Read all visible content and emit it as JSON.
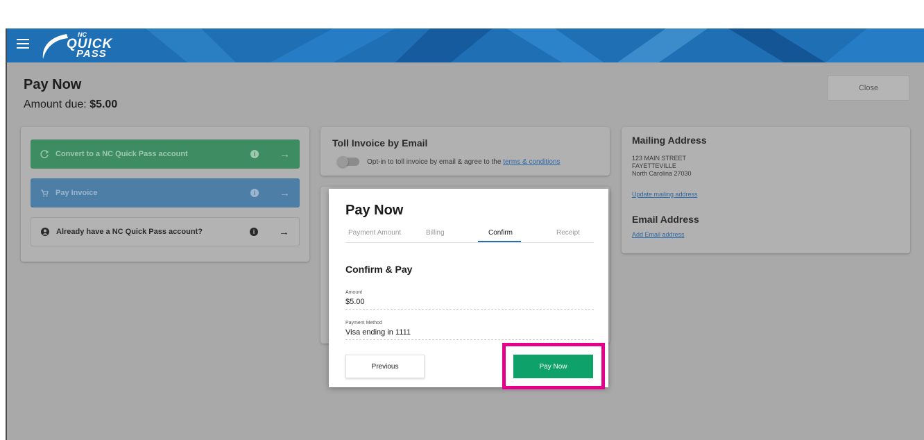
{
  "header": {
    "logo_nc": "NC",
    "logo_quick": "QUICK",
    "logo_pass": "PASS",
    "colors": {
      "bar": "#1f6fb5"
    }
  },
  "page": {
    "title": "Pay Now",
    "amount_due_label": "Amount due:",
    "amount_due_value": "$5.00",
    "close_label": "Close"
  },
  "actions": [
    {
      "label": "Convert to a NC Quick Pass account",
      "icon": "refresh-icon"
    },
    {
      "label": "Pay Invoice",
      "icon": "cart-icon"
    },
    {
      "label": "Already have a NC Quick Pass account?",
      "icon": "account-icon"
    }
  ],
  "toll_invoice": {
    "title": "Toll Invoice by Email",
    "optin_text": "Opt-in to toll invoice by email & agree to the",
    "terms_link": "terms & conditions"
  },
  "mailing": {
    "title": "Mailing Address",
    "line1": "123 MAIN STREET",
    "line2": "FAYETTEVILLE",
    "line3": "North Carolina 27030",
    "update_link": "Update mailing address",
    "email_title": "Email Address",
    "add_email_link": "Add Email address"
  },
  "modal": {
    "title": "Pay Now",
    "steps": [
      "Payment Amount",
      "Billing",
      "Confirm",
      "Receipt"
    ],
    "active_step": "Confirm",
    "section_title": "Confirm & Pay",
    "amount_label": "Amount",
    "amount_value": "$5.00",
    "method_label": "Payment Method",
    "method_value": "Visa ending in 1111",
    "previous_label": "Previous",
    "pay_label": "Pay Now",
    "colors": {
      "pay": "#0ea26a",
      "highlight": "#e5008a"
    }
  }
}
